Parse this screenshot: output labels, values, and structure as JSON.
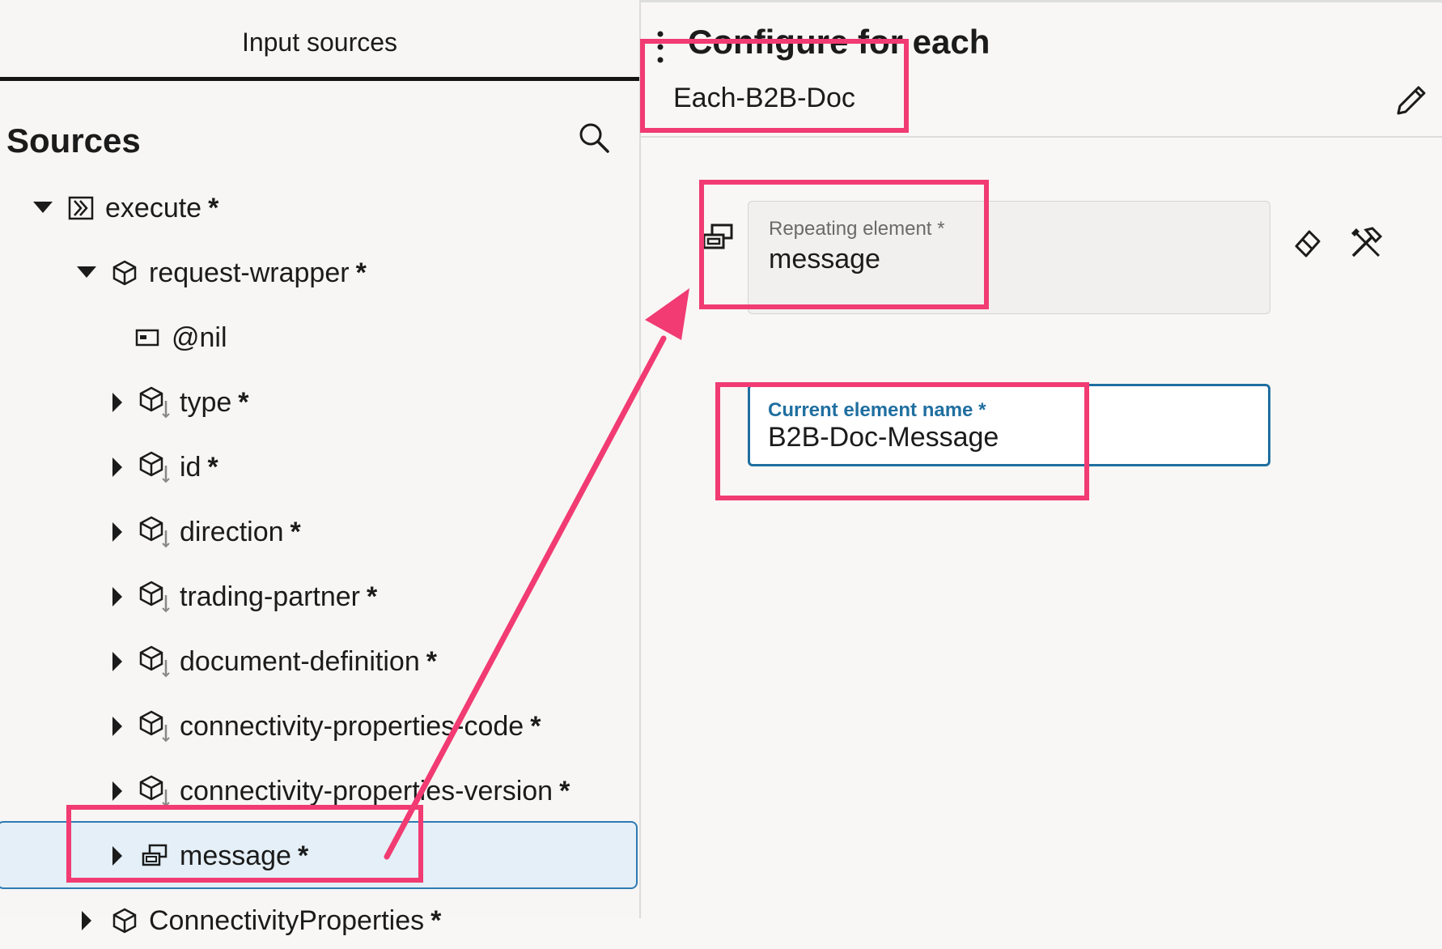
{
  "left": {
    "tab": "Input sources",
    "heading": "Sources",
    "tree": [
      {
        "label": "execute",
        "required": "*"
      },
      {
        "label": "request-wrapper",
        "required": "*"
      },
      {
        "label": "@nil",
        "required": ""
      },
      {
        "label": "type",
        "required": "*"
      },
      {
        "label": "id",
        "required": "*"
      },
      {
        "label": "direction",
        "required": "*"
      },
      {
        "label": "trading-partner",
        "required": "*"
      },
      {
        "label": "document-definition",
        "required": "*"
      },
      {
        "label": "connectivity-properties-code",
        "required": "*"
      },
      {
        "label": "connectivity-properties-version",
        "required": "*"
      },
      {
        "label": "message",
        "required": "*"
      },
      {
        "label": "ConnectivityProperties",
        "required": "*"
      }
    ]
  },
  "right": {
    "title": "Configure for each",
    "subtitle": "Each-B2B-Doc",
    "repeating_label": "Repeating element *",
    "repeating_value": "message",
    "current_label": "Current element name *",
    "current_value": "B2B-Doc-Message"
  },
  "colors": {
    "annotation": "#f13b72",
    "focus": "#1f6fa0",
    "selection": "#e4eff7"
  },
  "icons": [
    "search-icon",
    "kebab-icon",
    "pencil-icon",
    "repeat-icon",
    "eraser-icon",
    "tools-icon",
    "caret-down-icon",
    "caret-right-icon",
    "cube-icon",
    "operation-icon",
    "attribute-icon"
  ]
}
